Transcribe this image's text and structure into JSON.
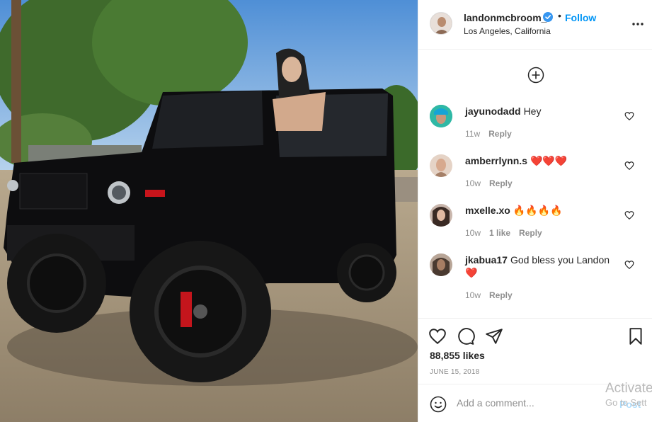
{
  "post": {
    "username": "landonmcbroom_",
    "follow_label": "Follow",
    "separator": "•",
    "location": "Los Angeles, California",
    "more_icon": "more-options-icon",
    "load_more_icon": "load-more-comments-icon"
  },
  "comments": [
    {
      "user": "jayunodadd",
      "text": "Hey",
      "time": "11w",
      "likes": "",
      "reply": "Reply",
      "avatar_color": "#2fb8a5"
    },
    {
      "user": "amberrlynn.s",
      "text": "❤️❤️❤️",
      "time": "10w",
      "likes": "",
      "reply": "Reply",
      "avatar_color": "#d7b7a2"
    },
    {
      "user": "mxelle.xo",
      "text": "🔥🔥🔥🔥",
      "time": "10w",
      "likes": "1 like",
      "reply": "Reply",
      "avatar_color": "#5b4a44"
    },
    {
      "user": "jkabua17",
      "text": "God bless you Landon ❤️",
      "time": "10w",
      "likes": "",
      "reply": "Reply",
      "avatar_color": "#6f5a4e"
    }
  ],
  "actions": {
    "like_icon": "heart-icon",
    "comment_icon": "comment-icon",
    "share_icon": "share-icon",
    "save_icon": "bookmark-icon",
    "likes": "88,855 likes",
    "date": "JUNE 15, 2018"
  },
  "add_comment": {
    "placeholder": "Add a comment...",
    "post_label": "Post",
    "emoji_icon": "emoji-icon"
  },
  "watermark": {
    "line1": "Activate",
    "line2": "Go to Sett"
  },
  "colors": {
    "accent": "#0095f6",
    "text": "#262626",
    "muted": "#8e8e8e",
    "border": "#efefef"
  }
}
